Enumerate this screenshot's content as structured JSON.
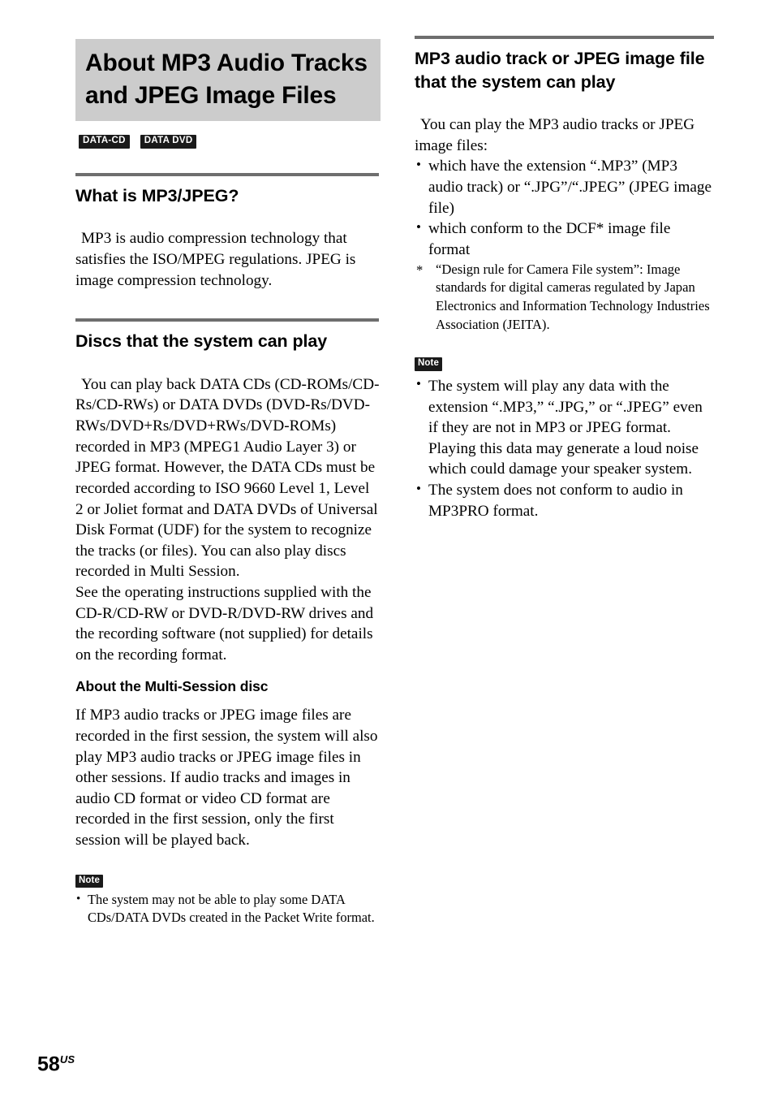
{
  "page": {
    "number": "58",
    "region_suffix": "US",
    "accent_rule_color": "#6e6e6e",
    "title_block_color": "#cccccc",
    "badge_color": "#1a1a1a"
  },
  "left_column": {
    "title": "About MP3 Audio Tracks and JPEG Image Files",
    "disc_badges": [
      {
        "label": "DATA-CD"
      },
      {
        "label": "DATA DVD"
      }
    ],
    "sections": [
      {
        "heading": "What is MP3/JPEG?",
        "paragraphs": [
          "MP3 is audio compression technology that satisfies the ISO/MPEG regulations. JPEG is image compression technology."
        ]
      },
      {
        "heading": "Discs that the system can play",
        "paragraphs": [
          "You can play back DATA CDs (CD-ROMs/CD-Rs/CD-RWs) or DATA DVDs (DVD-Rs/DVD-RWs/DVD+Rs/DVD+RWs/DVD-ROMs) recorded in MP3 (MPEG1 Audio Layer 3) or JPEG format. However, the DATA CDs must be recorded according to ISO 9660 Level 1, Level 2 or Joliet format and DATA DVDs of Universal Disk Format (UDF) for the system to recognize the tracks (or files). You can also play discs recorded in Multi Session.",
          "See the operating instructions supplied with the CD-R/CD-RW or DVD-R/DVD-RW drives and the recording software (not supplied) for details on the recording format."
        ],
        "subsection": {
          "heading": "About the Multi-Session disc",
          "paragraph": "If MP3 audio tracks or JPEG image files are recorded in the first session, the system will also play MP3 audio tracks or JPEG image files in other sessions. If audio tracks and images in audio CD format or video CD format are recorded in the first session, only the first session will be played back."
        },
        "note": {
          "badge": "Note",
          "bullets": [
            "The system may not be able to play some DATA CDs/DATA DVDs created in the Packet Write format."
          ]
        }
      }
    ]
  },
  "right_column": {
    "heading": "MP3 audio track or JPEG image file that the system can play",
    "intro": "You can play the MP3 audio tracks or JPEG image files:",
    "bullets": [
      "which have the extension “.MP3” (MP3 audio track) or “.JPG”/“.JPEG” (JPEG image file)",
      "which conform to the DCF* image file format"
    ],
    "footnote": {
      "mark": "*",
      "text": "“Design rule for Camera File system”: Image standards for digital cameras regulated by Japan Electronics and Information Technology Industries Association (JEITA)."
    },
    "note": {
      "badge": "Note",
      "bullets": [
        "The system will play any data with the extension “.MP3,” “.JPG,” or “.JPEG” even if they are not in MP3 or JPEG format. Playing this data may generate a loud noise which could damage your speaker system.",
        "The system does not conform to audio in MP3PRO format."
      ]
    }
  }
}
